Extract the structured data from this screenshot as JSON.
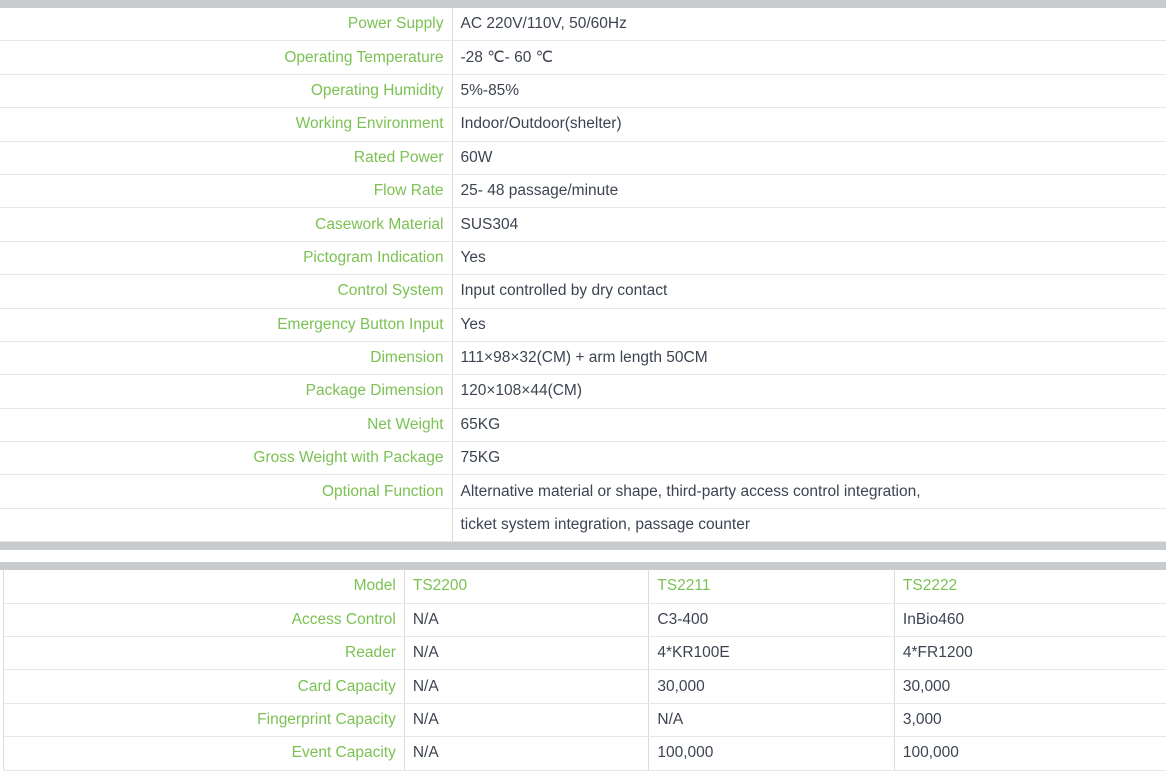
{
  "colors": {
    "label_green": "#7cc153",
    "value_text": "#3d4451",
    "rule_grey": "#c7cbce",
    "row_border": "#e6e6e6",
    "column_border": "#dcdcdc",
    "background": "#ffffff"
  },
  "specs_table": {
    "name": "general-specifications",
    "rows": [
      {
        "label": "Power Supply",
        "value": "AC 220V/110V, 50/60Hz"
      },
      {
        "label": "Operating Temperature",
        "value": "-28 ℃- 60 ℃"
      },
      {
        "label": "Operating Humidity",
        "value": "5%-85%"
      },
      {
        "label": "Working Environment",
        "value": "Indoor/Outdoor(shelter)"
      },
      {
        "label": "Rated Power",
        "value": "60W"
      },
      {
        "label": "Flow Rate",
        "value": "25- 48 passage/minute"
      },
      {
        "label": "Casework Material",
        "value": "SUS304"
      },
      {
        "label": "Pictogram Indication",
        "value": "Yes"
      },
      {
        "label": "Control System",
        "value": "Input controlled by dry contact"
      },
      {
        "label": "Emergency Button Input",
        "value": "Yes"
      },
      {
        "label": "Dimension",
        "value": "111×98×32(CM) + arm length 50CM"
      },
      {
        "label": "Package Dimension",
        "value": "120×108×44(CM)"
      },
      {
        "label": "Net Weight",
        "value": "65KG"
      },
      {
        "label": "Gross Weight with Package",
        "value": "75KG"
      },
      {
        "label": "Optional Function",
        "value": "Alternative material or shape, third-party access control integration,"
      },
      {
        "label": "",
        "value": "ticket system integration, passage counter"
      }
    ]
  },
  "models_table": {
    "name": "model-comparison",
    "header": {
      "label": "Model",
      "model_1": "TS2200",
      "model_2": "TS2211",
      "model_3": "TS2222"
    },
    "rows": [
      {
        "label": "Access Control",
        "model_1": "N/A",
        "model_2": "C3-400",
        "model_3": "InBio460"
      },
      {
        "label": "Reader",
        "model_1": "N/A",
        "model_2": "4*KR100E",
        "model_3": "4*FR1200"
      },
      {
        "label": "Card Capacity",
        "model_1": "N/A",
        "model_2": "30,000",
        "model_3": "30,000"
      },
      {
        "label": "Fingerprint Capacity",
        "model_1": "N/A",
        "model_2": "N/A",
        "model_3": "3,000"
      },
      {
        "label": "Event Capacity",
        "model_1": "N/A",
        "model_2": "100,000",
        "model_3": "100,000"
      }
    ]
  }
}
